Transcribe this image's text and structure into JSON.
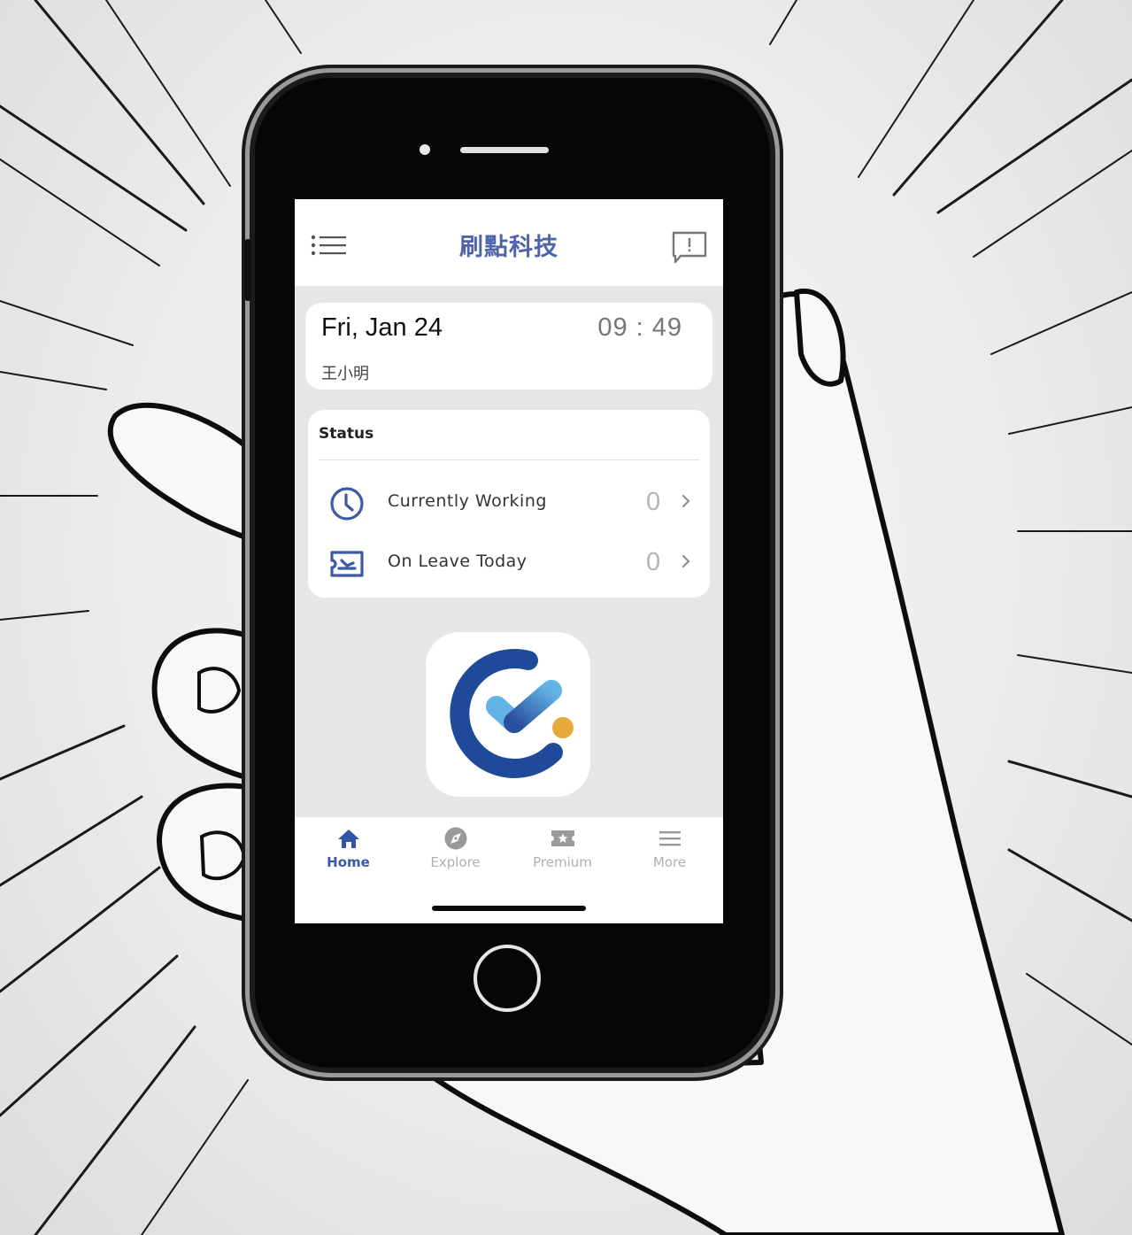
{
  "app": {
    "title": "刷點科技",
    "brand_color": "#4f64aa",
    "accent_color": "#3b5ba6"
  },
  "header": {
    "menu_icon": "list-menu-icon",
    "feedback_icon": "feedback-alert-icon"
  },
  "date_card": {
    "date": "Fri, Jan 24",
    "time": "09 : 49",
    "user_name": "王小明"
  },
  "status": {
    "title": "Status",
    "items": [
      {
        "icon": "clock-icon",
        "label": "Currently Working",
        "count": "0"
      },
      {
        "icon": "boarding-pass-icon",
        "label": "On Leave Today",
        "count": "0"
      }
    ]
  },
  "tabs": [
    {
      "icon": "home-icon",
      "label": "Home",
      "active": true
    },
    {
      "icon": "compass-icon",
      "label": "Explore",
      "active": false
    },
    {
      "icon": "ticket-star-icon",
      "label": "Premium",
      "active": false
    },
    {
      "icon": "hamburger-icon",
      "label": "More",
      "active": false
    }
  ]
}
